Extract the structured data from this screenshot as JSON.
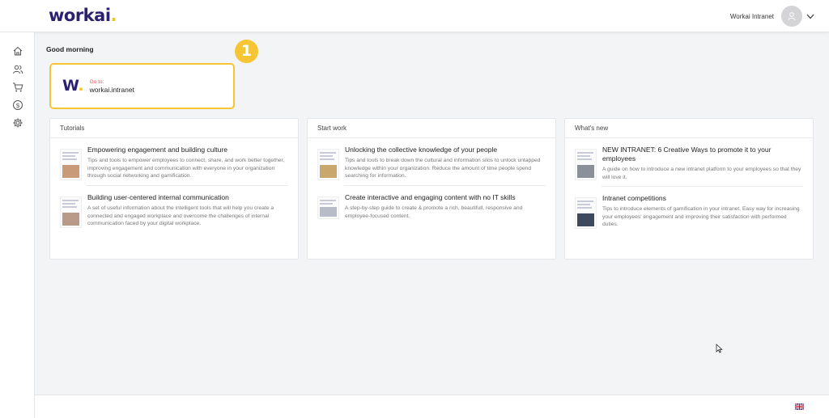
{
  "header": {
    "logo": "workai",
    "logo_dot": ".",
    "user_name": "Workai Intranet"
  },
  "sidebar": {
    "icons": [
      "home-icon",
      "people-icon",
      "cart-icon",
      "dollar-icon",
      "gear-icon"
    ]
  },
  "greeting": "Good morning",
  "step_badge": "1",
  "goto": {
    "logo": "W",
    "logo_dot": ".",
    "label": "Go to:",
    "link": "workai.intranet"
  },
  "cards": [
    {
      "title": "Tutorials",
      "items": [
        {
          "title": "Empowering engagement and building culture",
          "desc": "Tips and tools to empower employees to connect, share, and work better together, improving engagement and communication with everyone in your organization through social networking and gamification."
        },
        {
          "title": "Building user-centered internal communication",
          "desc": "A set of useful information about the intelligent tools that will help you create a connected and engaged workplace and overcome the challenges of internal communication faced by your digital workplace."
        }
      ]
    },
    {
      "title": "Start work",
      "items": [
        {
          "title": "Unlocking the collective knowledge of your people",
          "desc": "Tips and tools to break down the cultural and information silos to unlock untapped knowledge within your organization. Reduce the amount of time people spend searching for information."
        },
        {
          "title": "Create interactive and engaging content with no IT skills",
          "desc": "A step-by-step guide to create & promote a rich, beautifull, responsive and employee-focused content."
        }
      ]
    },
    {
      "title": "What's new",
      "items": [
        {
          "title": "NEW INTRANET: 6 Creative Ways to promote it to your employees",
          "desc": "A guide on how to introduce a new intranet platform to your employees so that they will love it."
        },
        {
          "title": "Intranet competitions",
          "desc": "Tips to introduce elements of gamification in your intranet. Easy way for increasing your employees' engagement and improving their satisfaction with performed duties."
        }
      ]
    }
  ],
  "footer": {
    "language_icon": "uk-flag-icon"
  }
}
